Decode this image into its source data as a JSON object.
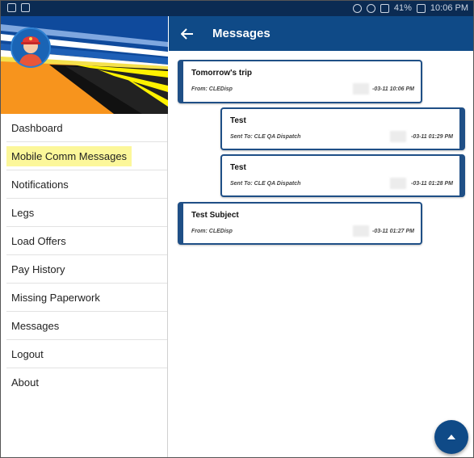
{
  "status_bar": {
    "left_icons": [
      "notification-icon",
      "image-icon"
    ],
    "right_icons": [
      "location-icon",
      "mute-icon",
      "wifi-icon",
      "battery-icon"
    ],
    "battery_text": "41%",
    "time": "10:06 PM"
  },
  "drawer": {
    "avatar": "driver-avatar",
    "items": [
      {
        "label": "Dashboard"
      },
      {
        "label": "Mobile Comm Messages",
        "highlighted": true
      },
      {
        "label": "Notifications"
      },
      {
        "label": "Legs"
      },
      {
        "label": "Load Offers"
      },
      {
        "label": "Pay History"
      },
      {
        "label": "Missing Paperwork"
      },
      {
        "label": "Messages"
      },
      {
        "label": "Logout"
      },
      {
        "label": "About"
      }
    ]
  },
  "appbar": {
    "title": "Messages",
    "back_icon": "arrow-left-icon"
  },
  "messages": [
    {
      "subject": "Tomorrow's trip",
      "meta": "From: CLEDisp",
      "date": "-03-11 10:06 PM",
      "direction": "received"
    },
    {
      "subject": "Test",
      "meta": "Sent To: CLE QA Dispatch",
      "date": "-03-11 01:29 PM",
      "direction": "sent"
    },
    {
      "subject": "Test",
      "meta": "Sent To: CLE QA Dispatch",
      "date": "-03-11 01:28 PM",
      "direction": "sent"
    },
    {
      "subject": "Test Subject",
      "meta": "From: CLEDisp",
      "date": "-03-11 01:27 PM",
      "direction": "received"
    }
  ],
  "fab": {
    "icon": "arrow-up-icon"
  },
  "colors": {
    "primary": "#0f4a87",
    "status_bar": "#0b2b53",
    "highlight": "#fcf79a",
    "card_border": "#1f4f86"
  }
}
